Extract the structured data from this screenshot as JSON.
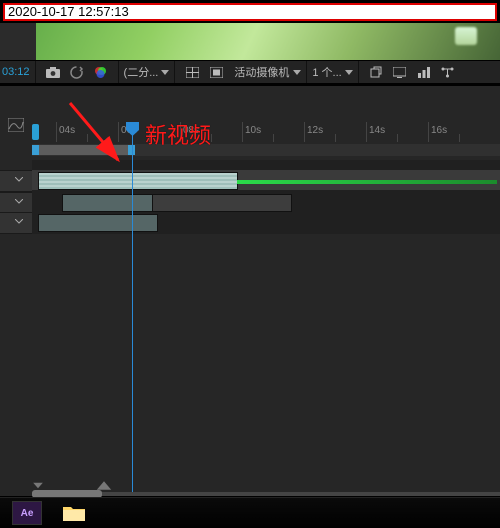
{
  "timestamp": "2020-10-17 12:57:13",
  "toolbar": {
    "timecode": "03:12",
    "resolution_dd": "(二分...",
    "camera_dd": "活动摄像机",
    "views_dd": "1 个..."
  },
  "ruler": {
    "ticks": [
      "04s",
      "06s",
      "08s",
      "10s",
      "12s",
      "14s",
      "16s"
    ]
  },
  "annotation": {
    "label": "新视频"
  },
  "icons": {
    "camera": "camera-icon",
    "refresh": "refresh-icon",
    "colorball": "color-icon",
    "grid": "grid-icon",
    "frame": "frame-icon",
    "share": "share-icon",
    "monitor": "monitor-icon",
    "chart": "chart-icon",
    "flow": "flow-icon",
    "graph": "graph-editor-icon"
  },
  "taskbar": {
    "ae": "Ae"
  }
}
